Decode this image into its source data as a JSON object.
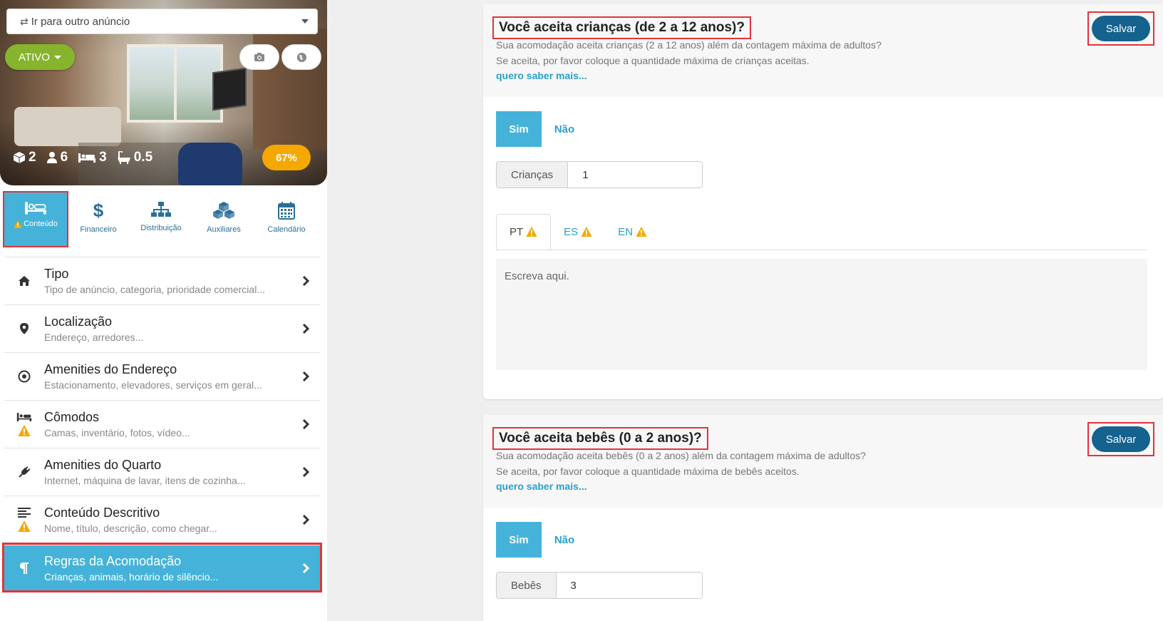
{
  "sidebar": {
    "goto_select": {
      "label": "Ir para outro anúncio"
    },
    "status": {
      "label": "ATIVO"
    },
    "stats": {
      "rooms": "2",
      "guests": "6",
      "beds": "3",
      "baths": "0.5"
    },
    "progress": {
      "label": "67%",
      "value_percent": 67
    },
    "nav_tabs": [
      {
        "label": "Conteúdo",
        "icon": "bed-icon",
        "warning": true,
        "active": true
      },
      {
        "label": "Financeiro",
        "icon": "dollar-icon",
        "warning": false,
        "active": false
      },
      {
        "label": "Distribuição",
        "icon": "sitemap-icon",
        "warning": false,
        "active": false
      },
      {
        "label": "Auxiliares",
        "icon": "cubes-icon",
        "warning": false,
        "active": false
      },
      {
        "label": "Calendário",
        "icon": "calendar-icon",
        "warning": false,
        "active": false
      }
    ],
    "menu": [
      {
        "title": "Tipo",
        "subtitle": "Tipo de anúncio, categoria, prioridade comercial...",
        "icon": "home-icon",
        "warning": false
      },
      {
        "title": "Localização",
        "subtitle": "Endereço, arredores...",
        "icon": "map-pin-icon",
        "warning": false
      },
      {
        "title": "Amenities do Endereço",
        "subtitle": "Estacionamento, elevadores, serviços em geral...",
        "icon": "target-icon",
        "warning": false
      },
      {
        "title": "Cômodos",
        "subtitle": "Camas, inventário, fotos, vídeo...",
        "icon": "bed-icon",
        "warning": true
      },
      {
        "title": "Amenities do Quarto",
        "subtitle": "Internet, máquina de lavar, itens de cozinha...",
        "icon": "plug-icon",
        "warning": false
      },
      {
        "title": "Conteúdo Descritivo",
        "subtitle": "Nome, título, descrição, como chegar...",
        "icon": "align-left-icon",
        "warning": true
      },
      {
        "title": "Regras da Acomodação",
        "subtitle": "Crianças, animais, horário de silêncio...",
        "icon": "paragraph-icon",
        "warning": false,
        "active": true
      }
    ]
  },
  "main": {
    "children_card": {
      "title": "Você aceita crianças (de 2 a 12 anos)?",
      "desc1": "Sua acomodação aceita crianças (2 a 12 anos) além da contagem máxima de adultos?",
      "desc2": "Se aceita, por favor coloque a quantidade máxima de crianças aceitas.",
      "learn_more": "quero saber mais...",
      "save_label": "Salvar",
      "yes_label": "Sim",
      "no_label": "Não",
      "selected": "Sim",
      "field_label": "Crianças",
      "field_value": "1",
      "lang_tabs": [
        "PT",
        "ES",
        "EN"
      ],
      "active_lang": "PT",
      "text_placeholder": "Escreva aqui."
    },
    "babies_card": {
      "title": "Você aceita bebês (0 a 2 anos)?",
      "desc1": "Sua acomodação aceita bebês (0 a 2 anos) além da contagem máxima de adultos?",
      "desc2": "Se aceita, por favor coloque a quantidade máxima de bebês aceitos.",
      "learn_more": "quero saber mais...",
      "save_label": "Salvar",
      "yes_label": "Sim",
      "no_label": "Não",
      "selected": "Sim",
      "field_label": "Bebês",
      "field_value": "3"
    }
  },
  "colors": {
    "primary": "#45b3d9",
    "dark_button": "#14628d",
    "status_green": "#86b52d",
    "progress_orange": "#f5a800",
    "warning": "#f5a800",
    "highlight_red": "#e0343a"
  }
}
